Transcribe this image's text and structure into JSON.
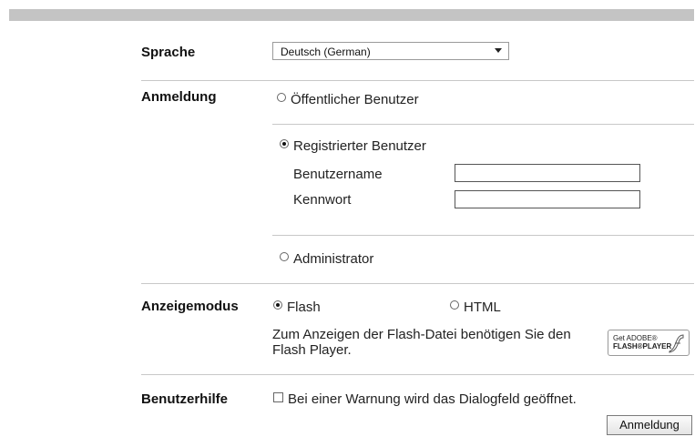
{
  "language": {
    "label": "Sprache",
    "selected": "Deutsch (German)"
  },
  "login": {
    "label": "Anmeldung",
    "public_user": "Öffentlicher Benutzer",
    "registered_user": "Registrierter Benutzer",
    "username_label": "Benutzername",
    "username_value": "",
    "password_label": "Kennwort",
    "password_value": "",
    "administrator": "Administrator",
    "selected": "Registrierter Benutzer"
  },
  "display_mode": {
    "label": "Anzeigemodus",
    "flash": "Flash",
    "html": "HTML",
    "selected": "Flash",
    "note": "Zum Anzeigen der Flash-Datei benötigen Sie den Flash Player.",
    "badge_line1": "Get ADOBE®",
    "badge_line2": "FLASH®PLAYER"
  },
  "help": {
    "label": "Benutzerhilfe",
    "checkbox_label": "Bei einer Warnung wird das Dialogfeld geöffnet.",
    "checked": false
  },
  "submit_label": "Anmeldung"
}
